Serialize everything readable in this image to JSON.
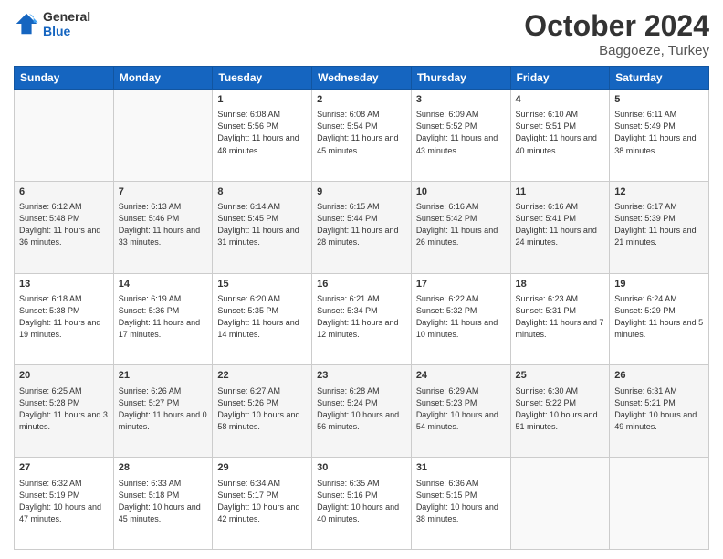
{
  "header": {
    "logo_line1": "General",
    "logo_line2": "Blue",
    "main_title": "October 2024",
    "subtitle": "Baggoeze, Turkey"
  },
  "days_of_week": [
    "Sunday",
    "Monday",
    "Tuesday",
    "Wednesday",
    "Thursday",
    "Friday",
    "Saturday"
  ],
  "weeks": [
    [
      {
        "day": "",
        "empty": true
      },
      {
        "day": "",
        "empty": true
      },
      {
        "day": "1",
        "sunrise": "Sunrise: 6:08 AM",
        "sunset": "Sunset: 5:56 PM",
        "daylight": "Daylight: 11 hours and 48 minutes."
      },
      {
        "day": "2",
        "sunrise": "Sunrise: 6:08 AM",
        "sunset": "Sunset: 5:54 PM",
        "daylight": "Daylight: 11 hours and 45 minutes."
      },
      {
        "day": "3",
        "sunrise": "Sunrise: 6:09 AM",
        "sunset": "Sunset: 5:52 PM",
        "daylight": "Daylight: 11 hours and 43 minutes."
      },
      {
        "day": "4",
        "sunrise": "Sunrise: 6:10 AM",
        "sunset": "Sunset: 5:51 PM",
        "daylight": "Daylight: 11 hours and 40 minutes."
      },
      {
        "day": "5",
        "sunrise": "Sunrise: 6:11 AM",
        "sunset": "Sunset: 5:49 PM",
        "daylight": "Daylight: 11 hours and 38 minutes."
      }
    ],
    [
      {
        "day": "6",
        "sunrise": "Sunrise: 6:12 AM",
        "sunset": "Sunset: 5:48 PM",
        "daylight": "Daylight: 11 hours and 36 minutes."
      },
      {
        "day": "7",
        "sunrise": "Sunrise: 6:13 AM",
        "sunset": "Sunset: 5:46 PM",
        "daylight": "Daylight: 11 hours and 33 minutes."
      },
      {
        "day": "8",
        "sunrise": "Sunrise: 6:14 AM",
        "sunset": "Sunset: 5:45 PM",
        "daylight": "Daylight: 11 hours and 31 minutes."
      },
      {
        "day": "9",
        "sunrise": "Sunrise: 6:15 AM",
        "sunset": "Sunset: 5:44 PM",
        "daylight": "Daylight: 11 hours and 28 minutes."
      },
      {
        "day": "10",
        "sunrise": "Sunrise: 6:16 AM",
        "sunset": "Sunset: 5:42 PM",
        "daylight": "Daylight: 11 hours and 26 minutes."
      },
      {
        "day": "11",
        "sunrise": "Sunrise: 6:16 AM",
        "sunset": "Sunset: 5:41 PM",
        "daylight": "Daylight: 11 hours and 24 minutes."
      },
      {
        "day": "12",
        "sunrise": "Sunrise: 6:17 AM",
        "sunset": "Sunset: 5:39 PM",
        "daylight": "Daylight: 11 hours and 21 minutes."
      }
    ],
    [
      {
        "day": "13",
        "sunrise": "Sunrise: 6:18 AM",
        "sunset": "Sunset: 5:38 PM",
        "daylight": "Daylight: 11 hours and 19 minutes."
      },
      {
        "day": "14",
        "sunrise": "Sunrise: 6:19 AM",
        "sunset": "Sunset: 5:36 PM",
        "daylight": "Daylight: 11 hours and 17 minutes."
      },
      {
        "day": "15",
        "sunrise": "Sunrise: 6:20 AM",
        "sunset": "Sunset: 5:35 PM",
        "daylight": "Daylight: 11 hours and 14 minutes."
      },
      {
        "day": "16",
        "sunrise": "Sunrise: 6:21 AM",
        "sunset": "Sunset: 5:34 PM",
        "daylight": "Daylight: 11 hours and 12 minutes."
      },
      {
        "day": "17",
        "sunrise": "Sunrise: 6:22 AM",
        "sunset": "Sunset: 5:32 PM",
        "daylight": "Daylight: 11 hours and 10 minutes."
      },
      {
        "day": "18",
        "sunrise": "Sunrise: 6:23 AM",
        "sunset": "Sunset: 5:31 PM",
        "daylight": "Daylight: 11 hours and 7 minutes."
      },
      {
        "day": "19",
        "sunrise": "Sunrise: 6:24 AM",
        "sunset": "Sunset: 5:29 PM",
        "daylight": "Daylight: 11 hours and 5 minutes."
      }
    ],
    [
      {
        "day": "20",
        "sunrise": "Sunrise: 6:25 AM",
        "sunset": "Sunset: 5:28 PM",
        "daylight": "Daylight: 11 hours and 3 minutes."
      },
      {
        "day": "21",
        "sunrise": "Sunrise: 6:26 AM",
        "sunset": "Sunset: 5:27 PM",
        "daylight": "Daylight: 11 hours and 0 minutes."
      },
      {
        "day": "22",
        "sunrise": "Sunrise: 6:27 AM",
        "sunset": "Sunset: 5:26 PM",
        "daylight": "Daylight: 10 hours and 58 minutes."
      },
      {
        "day": "23",
        "sunrise": "Sunrise: 6:28 AM",
        "sunset": "Sunset: 5:24 PM",
        "daylight": "Daylight: 10 hours and 56 minutes."
      },
      {
        "day": "24",
        "sunrise": "Sunrise: 6:29 AM",
        "sunset": "Sunset: 5:23 PM",
        "daylight": "Daylight: 10 hours and 54 minutes."
      },
      {
        "day": "25",
        "sunrise": "Sunrise: 6:30 AM",
        "sunset": "Sunset: 5:22 PM",
        "daylight": "Daylight: 10 hours and 51 minutes."
      },
      {
        "day": "26",
        "sunrise": "Sunrise: 6:31 AM",
        "sunset": "Sunset: 5:21 PM",
        "daylight": "Daylight: 10 hours and 49 minutes."
      }
    ],
    [
      {
        "day": "27",
        "sunrise": "Sunrise: 6:32 AM",
        "sunset": "Sunset: 5:19 PM",
        "daylight": "Daylight: 10 hours and 47 minutes."
      },
      {
        "day": "28",
        "sunrise": "Sunrise: 6:33 AM",
        "sunset": "Sunset: 5:18 PM",
        "daylight": "Daylight: 10 hours and 45 minutes."
      },
      {
        "day": "29",
        "sunrise": "Sunrise: 6:34 AM",
        "sunset": "Sunset: 5:17 PM",
        "daylight": "Daylight: 10 hours and 42 minutes."
      },
      {
        "day": "30",
        "sunrise": "Sunrise: 6:35 AM",
        "sunset": "Sunset: 5:16 PM",
        "daylight": "Daylight: 10 hours and 40 minutes."
      },
      {
        "day": "31",
        "sunrise": "Sunrise: 6:36 AM",
        "sunset": "Sunset: 5:15 PM",
        "daylight": "Daylight: 10 hours and 38 minutes."
      },
      {
        "day": "",
        "empty": true
      },
      {
        "day": "",
        "empty": true
      }
    ]
  ]
}
